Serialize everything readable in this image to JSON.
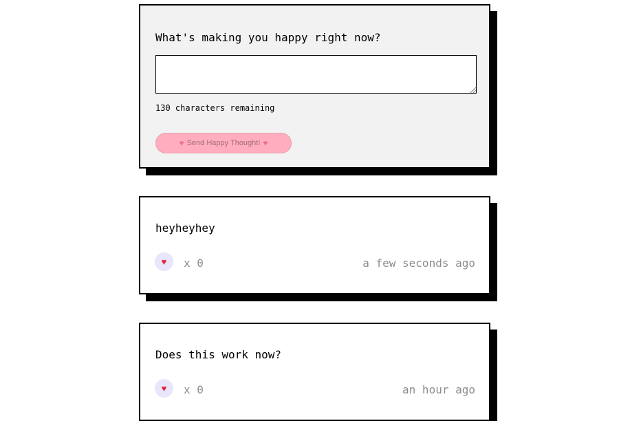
{
  "form": {
    "question": "What's making you happy right now?",
    "textarea_value": "",
    "char_count_text": "130 characters remaining",
    "send_label": "Send Happy Thought!",
    "heart_glyph": "♥"
  },
  "thoughts": [
    {
      "message": "heyheyhey",
      "like_icon": "heart-icon",
      "like_glyph": "♥",
      "likes_text": "x 0",
      "time": "a few seconds ago"
    },
    {
      "message": "Does this work now?",
      "like_icon": "heart-icon",
      "like_glyph": "♥",
      "likes_text": "x 0",
      "time": "an hour ago"
    }
  ],
  "colors": {
    "form_bg": "#f2f2f2",
    "button_bg": "#ffadbf",
    "like_bg": "#e8e6fa",
    "heart": "#e0253f",
    "muted_text": "#8c8c8c",
    "shadow": "#000000"
  }
}
